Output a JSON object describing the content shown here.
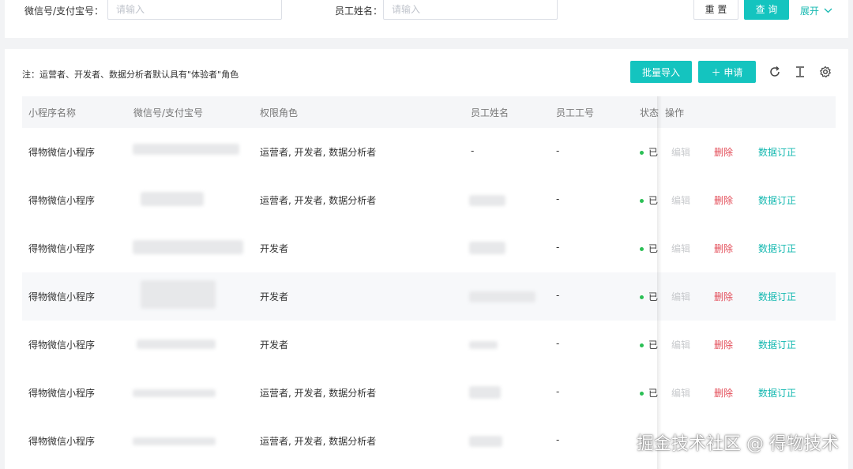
{
  "search": {
    "account_label": "微信号/支付宝号：",
    "account_placeholder": "请输入",
    "employee_label": "员工姓名：",
    "employee_placeholder": "请输入",
    "reset_label": "重 置",
    "query_label": "查 询",
    "expand_label": "展开"
  },
  "toolbar": {
    "note": "注：运营者、开发者、数据分析者默认具有\"体验者\"角色",
    "import_label": "批量导入",
    "apply_label": "＋ 申请"
  },
  "table": {
    "columns": [
      "小程序名称",
      "微信号/支付宝号",
      "权限角色",
      "员工姓名",
      "员工工号",
      "状态",
      "操作"
    ],
    "rows": [
      {
        "app": "得物微信小程序",
        "roles": "运营者, 开发者, 数据分析者",
        "employee_name": "-",
        "employee_id": "-",
        "status": "已"
      },
      {
        "app": "得物微信小程序",
        "roles": "运营者, 开发者, 数据分析者",
        "employee_name": "",
        "employee_id": "-",
        "status": "已"
      },
      {
        "app": "得物微信小程序",
        "roles": "开发者",
        "employee_name": "",
        "employee_id": "-",
        "status": "已"
      },
      {
        "app": "得物微信小程序",
        "roles": "开发者",
        "employee_name": "",
        "employee_id": "-",
        "status": "已"
      },
      {
        "app": "得物微信小程序",
        "roles": "开发者",
        "employee_name": "",
        "employee_id": "-",
        "status": "已"
      },
      {
        "app": "得物微信小程序",
        "roles": "运营者, 开发者, 数据分析者",
        "employee_name": "",
        "employee_id": "-",
        "status": "已"
      },
      {
        "app": "得物微信小程序",
        "roles": "运营者, 开发者, 数据分析者",
        "employee_name": "",
        "employee_id": "-",
        "status": ""
      }
    ],
    "actions": {
      "edit": "编辑",
      "delete": "删除",
      "fix": "数据订正"
    }
  },
  "watermark": "掘金技术社区 @ 得物技术",
  "colors": {
    "primary": "#14c4bf",
    "danger": "#e34d59",
    "success": "#2bbf55"
  },
  "icons": [
    "refresh-icon",
    "column-height-icon",
    "settings-icon",
    "chevron-down-icon"
  ]
}
